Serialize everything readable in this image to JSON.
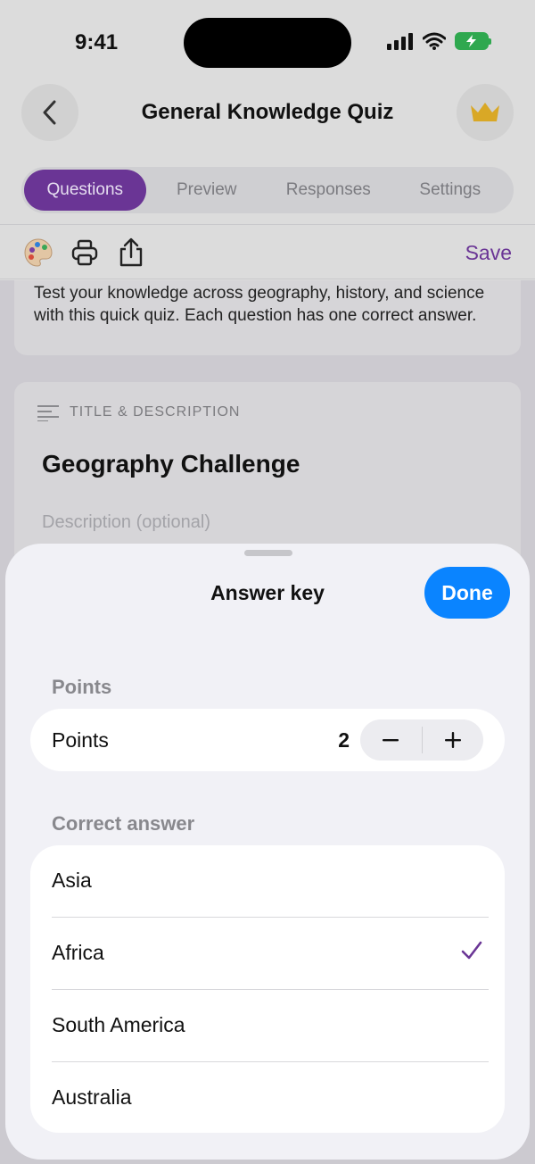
{
  "status_bar": {
    "time": "9:41"
  },
  "nav": {
    "title": "General Knowledge Quiz"
  },
  "tabs": [
    {
      "label": "Questions",
      "active": true
    },
    {
      "label": "Preview",
      "active": false
    },
    {
      "label": "Responses",
      "active": false
    },
    {
      "label": "Settings",
      "active": false
    }
  ],
  "toolbar": {
    "save_label": "Save"
  },
  "quiz_description": "Test your knowledge across geography, history, and science with this quick quiz. Each question has one correct answer.",
  "section": {
    "label": "TITLE & DESCRIPTION",
    "title": "Geography Challenge",
    "description_placeholder": "Description (optional)"
  },
  "sheet": {
    "title": "Answer key",
    "done_label": "Done",
    "points_group_label": "Points",
    "points_label": "Points",
    "points_value": "2",
    "correct_group_label": "Correct answer",
    "answers": [
      {
        "label": "Asia",
        "selected": false
      },
      {
        "label": "Africa",
        "selected": true
      },
      {
        "label": "South America",
        "selected": false
      },
      {
        "label": "Australia",
        "selected": false
      }
    ]
  },
  "colors": {
    "accent": "#6a3595",
    "done_button": "#0a84ff",
    "battery": "#2fa84f"
  }
}
